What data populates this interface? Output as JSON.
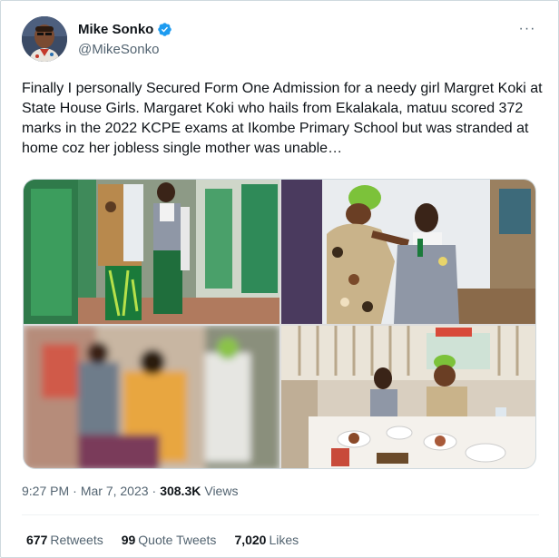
{
  "author": {
    "name": "Mike Sonko",
    "handle": "@MikeSonko",
    "verified": true,
    "verified_color": "#1d9bf0"
  },
  "more_label": "···",
  "tweet": {
    "text": "Finally I personally Secured Form One Admission for a needy girl Margret Koki at State House Girls. Margaret  Koki who hails from Ekalakala, matuu scored 372 marks in the 2022 KCPE exams at Ikombe Primary School but was stranded at home coz her jobless single mother was unable…"
  },
  "media": {
    "photo_count": 4
  },
  "meta": {
    "time": "9:27 PM",
    "separator": "·",
    "date": "Mar 7, 2023",
    "views_count": "308.3K",
    "views_label": "Views"
  },
  "stats": {
    "retweets_count": "677",
    "retweets_label": "Retweets",
    "quotes_count": "99",
    "quotes_label": "Quote Tweets",
    "likes_count": "7,020",
    "likes_label": "Likes"
  },
  "colors": {
    "text_primary": "#0f1419",
    "text_secondary": "#536471",
    "border": "#cfd9de"
  }
}
